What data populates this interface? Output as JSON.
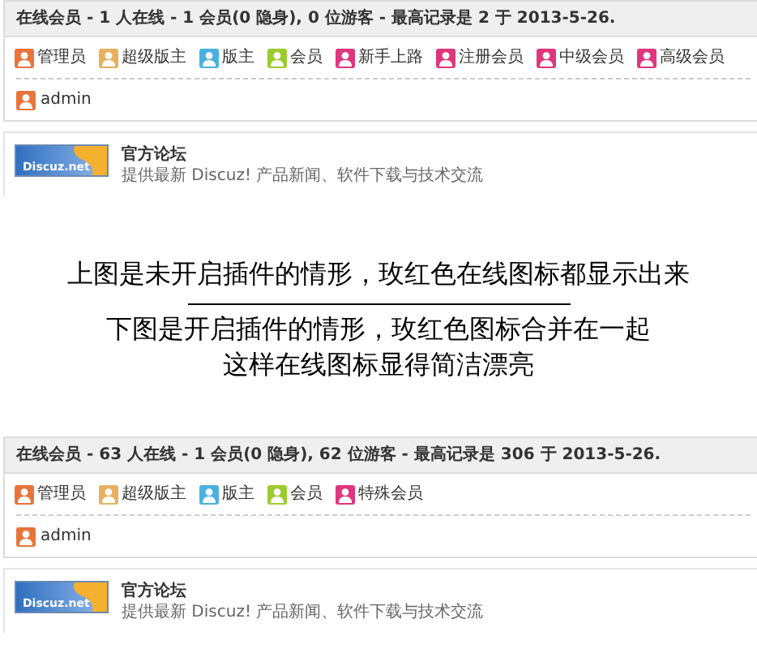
{
  "panels": [
    {
      "header": "在线会员 - 1 人在线 - 1 会员(0 隐身), 0 位游客 - 最高记录是 2 于 2013-5-26.",
      "legend": [
        {
          "label": "管理员",
          "color": "#e8743b"
        },
        {
          "label": "超级版主",
          "color": "#e8b060"
        },
        {
          "label": "版主",
          "color": "#49b1e0"
        },
        {
          "label": "会员",
          "color": "#9ccb2e"
        },
        {
          "label": "新手上路",
          "color": "#e0367e"
        },
        {
          "label": "注册会员",
          "color": "#e0367e"
        },
        {
          "label": "中级会员",
          "color": "#e0367e"
        },
        {
          "label": "高级会员",
          "color": "#e0367e"
        }
      ],
      "users": [
        {
          "name": "admin",
          "color": "#e8743b"
        }
      ],
      "forum": {
        "logo_text": "Discuz.net",
        "title": "官方论坛",
        "description": "提供最新 Discuz! 产品新闻、软件下载与技术交流"
      }
    },
    {
      "header": "在线会员 - 63 人在线 - 1 会员(0 隐身), 62 位游客 - 最高记录是 306 于 2013-5-26.",
      "legend": [
        {
          "label": "管理员",
          "color": "#e8743b"
        },
        {
          "label": "超级版主",
          "color": "#e8b060"
        },
        {
          "label": "版主",
          "color": "#49b1e0"
        },
        {
          "label": "会员",
          "color": "#9ccb2e"
        },
        {
          "label": "特殊会员",
          "color": "#e0367e"
        }
      ],
      "users": [
        {
          "name": "admin",
          "color": "#e8743b"
        }
      ],
      "forum": {
        "logo_text": "Discuz.net",
        "title": "官方论坛",
        "description": "提供最新 Discuz! 产品新闻、软件下载与技术交流"
      }
    }
  ],
  "message": [
    "上图是未开启插件的情形，玫红色在线图标都显示出来",
    "下图是开启插件的情形，玫红色图标合并在一起",
    "这样在线图标显得简洁漂亮"
  ]
}
